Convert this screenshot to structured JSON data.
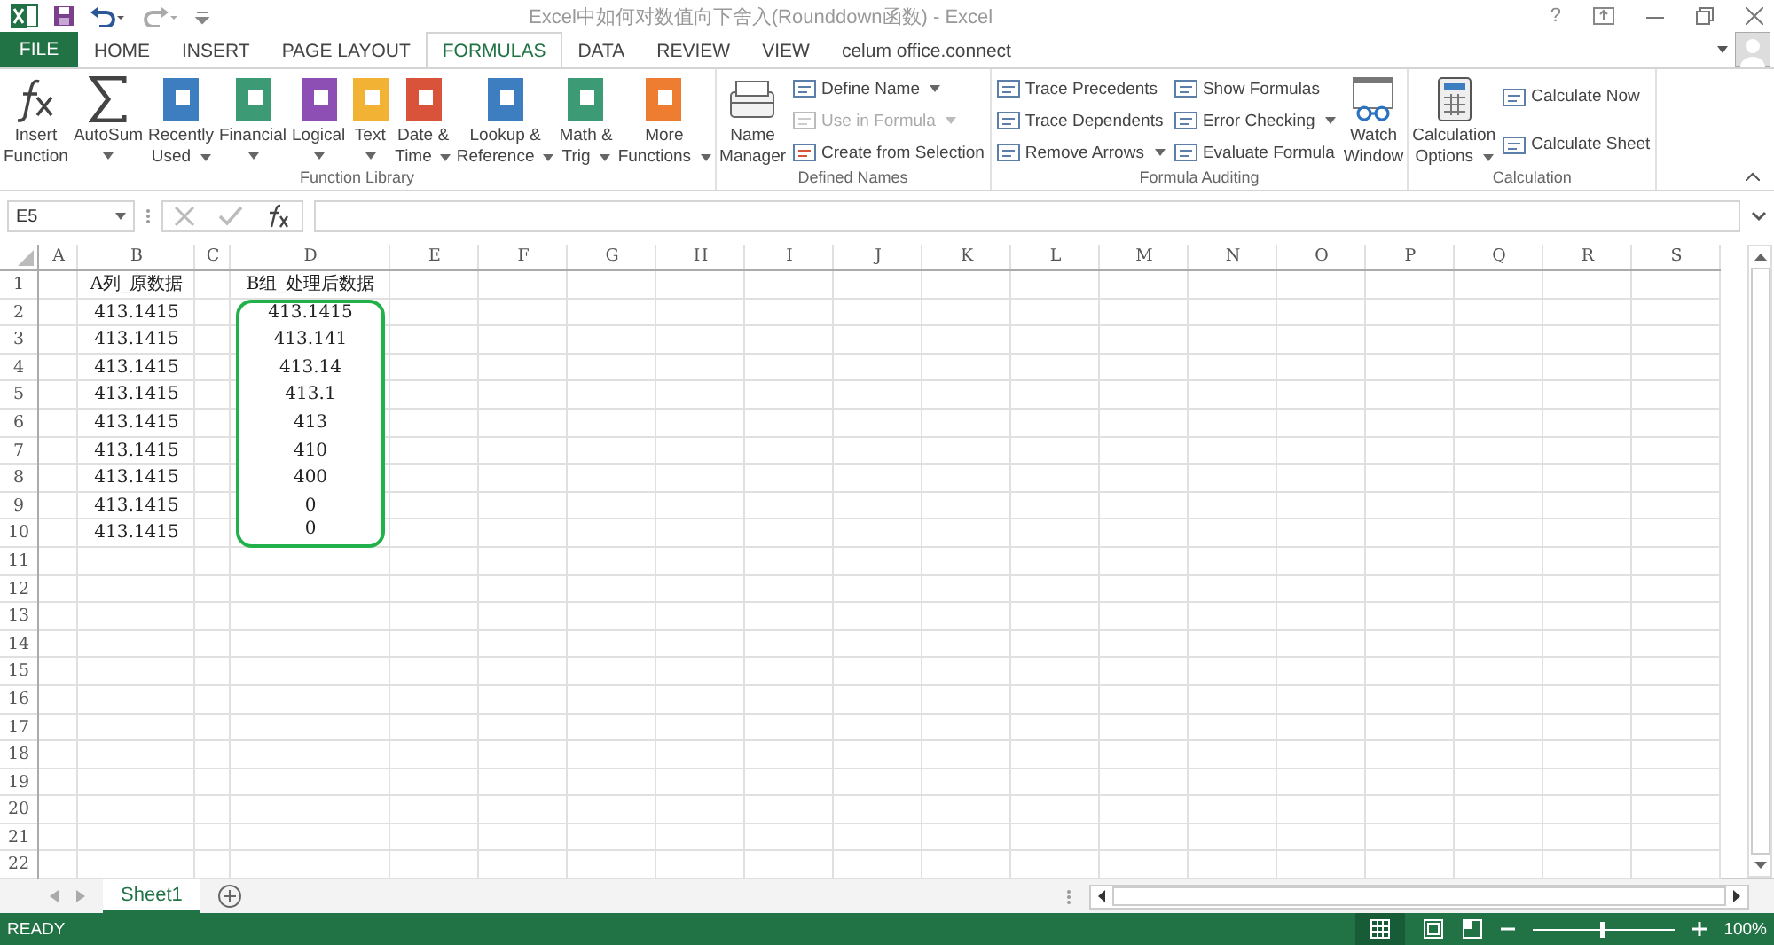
{
  "window": {
    "title": "Excel中如何对数值向下舍入(Rounddown函数) - Excel",
    "help": "?"
  },
  "tabs": [
    {
      "label": "FILE",
      "kind": "file",
      "selected": false
    },
    {
      "label": "HOME",
      "kind": "tab",
      "selected": false
    },
    {
      "label": "INSERT",
      "kind": "tab",
      "selected": false
    },
    {
      "label": "PAGE LAYOUT",
      "kind": "tab",
      "selected": false
    },
    {
      "label": "FORMULAS",
      "kind": "tab",
      "selected": true
    },
    {
      "label": "DATA",
      "kind": "tab",
      "selected": false
    },
    {
      "label": "REVIEW",
      "kind": "tab",
      "selected": false
    },
    {
      "label": "VIEW",
      "kind": "tab",
      "selected": false
    },
    {
      "label": "celum office.connect",
      "kind": "tab",
      "selected": false
    }
  ],
  "ribbon": [
    {
      "label": "Function Library",
      "items": [
        {
          "kind": "function",
          "lines": [
            "Insert",
            "Function"
          ],
          "dropdown": false
        },
        {
          "kind": "sum",
          "lines": [
            "AutoSum"
          ],
          "dropdown": true
        },
        {
          "kind": "book",
          "color": "#3d7ec1",
          "lines": [
            "Recently",
            "Used"
          ],
          "dropdown": true
        },
        {
          "kind": "book",
          "color": "#3c9a74",
          "lines": [
            "Financial"
          ],
          "dropdown": true
        },
        {
          "kind": "book",
          "color": "#8e4fb5",
          "lines": [
            "Logical"
          ],
          "dropdown": true
        },
        {
          "kind": "book",
          "color": "#f2b233",
          "lines": [
            "Text"
          ],
          "dropdown": true
        },
        {
          "kind": "book",
          "color": "#d9533a",
          "lines": [
            "Date &",
            "Time"
          ],
          "dropdown": true
        },
        {
          "kind": "book",
          "color": "#3d7ec1",
          "lines": [
            "Lookup &",
            "Reference"
          ],
          "dropdown": true
        },
        {
          "kind": "book",
          "color": "#3c9a74",
          "lines": [
            "Math &",
            "Trig"
          ],
          "dropdown": true
        },
        {
          "kind": "book",
          "color": "#ee7d31",
          "lines": [
            "More",
            "Functions"
          ],
          "dropdown": true
        }
      ]
    },
    {
      "label": "Defined Names",
      "items": [
        {
          "kind": "manager",
          "lines": [
            "Name",
            "Manager"
          ],
          "dropdown": false
        },
        {
          "kind": "small",
          "column": [
            {
              "label": "Define Name",
              "dropdown": true,
              "disabled": false
            },
            {
              "label": "Use in Formula",
              "dropdown": true,
              "disabled": true
            },
            {
              "label": "Create from Selection",
              "dropdown": false,
              "disabled": false
            }
          ]
        }
      ]
    },
    {
      "label": "Formula Auditing",
      "items": [
        {
          "kind": "small",
          "column": [
            {
              "label": "Trace Precedents",
              "dropdown": false,
              "disabled": false
            },
            {
              "label": "Trace Dependents",
              "dropdown": false,
              "disabled": false
            },
            {
              "label": "Remove Arrows",
              "dropdown": true,
              "disabled": false
            }
          ]
        },
        {
          "kind": "small",
          "column": [
            {
              "label": "Show Formulas",
              "dropdown": false,
              "disabled": false
            },
            {
              "label": "Error Checking",
              "dropdown": true,
              "disabled": false
            },
            {
              "label": "Evaluate Formula",
              "dropdown": false,
              "disabled": false
            }
          ]
        },
        {
          "kind": "watch",
          "lines": [
            "Watch",
            "Window"
          ],
          "dropdown": false
        }
      ]
    },
    {
      "label": "Calculation",
      "items": [
        {
          "kind": "calc",
          "lines": [
            "Calculation",
            "Options"
          ],
          "dropdown": true
        },
        {
          "kind": "small",
          "column": [
            {
              "label": "Calculate Now",
              "dropdown": false,
              "disabled": false
            },
            {
              "label": "Calculate Sheet",
              "dropdown": false,
              "disabled": false
            }
          ]
        }
      ]
    }
  ],
  "formula_bar": {
    "name_box": "E5"
  },
  "columns": [
    "A",
    "B",
    "C",
    "D",
    "E",
    "F",
    "G",
    "H",
    "I",
    "J",
    "K",
    "L",
    "M",
    "N",
    "O",
    "P",
    "Q",
    "R",
    "S"
  ],
  "rows": [
    {
      "label": "1",
      "values": {
        "B": "A列_原数据",
        "D": "B组_处理后数据"
      },
      "outlined": false
    },
    {
      "label": "2",
      "values": {
        "B": "413.1415",
        "D": "413.1415"
      },
      "outlined": true
    },
    {
      "label": "3",
      "values": {
        "B": "413.1415",
        "D": "413.141"
      },
      "outlined": true
    },
    {
      "label": "4",
      "values": {
        "B": "413.1415",
        "D": "413.14"
      },
      "outlined": true
    },
    {
      "label": "5",
      "values": {
        "B": "413.1415",
        "D": "413.1"
      },
      "outlined": true
    },
    {
      "label": "6",
      "values": {
        "B": "413.1415",
        "D": "413"
      },
      "outlined": true
    },
    {
      "label": "7",
      "values": {
        "B": "413.1415",
        "D": "410"
      },
      "outlined": true
    },
    {
      "label": "8",
      "values": {
        "B": "413.1415",
        "D": "400"
      },
      "outlined": true
    },
    {
      "label": "9",
      "values": {
        "B": "413.1415",
        "D": "0"
      },
      "outlined": true
    },
    {
      "label": "10",
      "values": {
        "B": "413.1415",
        "D": "0"
      },
      "outlined": true
    },
    {
      "label": "11",
      "outlined": false
    },
    {
      "label": "12",
      "outlined": false
    },
    {
      "label": "13",
      "outlined": false
    },
    {
      "label": "14",
      "outlined": false
    },
    {
      "label": "15",
      "outlined": false
    },
    {
      "label": "16",
      "outlined": false
    },
    {
      "label": "17",
      "outlined": false
    },
    {
      "label": "18",
      "outlined": false
    },
    {
      "label": "19",
      "outlined": false
    },
    {
      "label": "20",
      "outlined": false
    },
    {
      "label": "21",
      "outlined": false
    },
    {
      "label": "22",
      "outlined": false
    }
  ],
  "sheets": [
    {
      "label": "Sheet1",
      "selected": true
    }
  ],
  "status_bar": {
    "text": "READY",
    "zoom": "100%",
    "zoom_slider": {
      "level": 0.5
    }
  }
}
